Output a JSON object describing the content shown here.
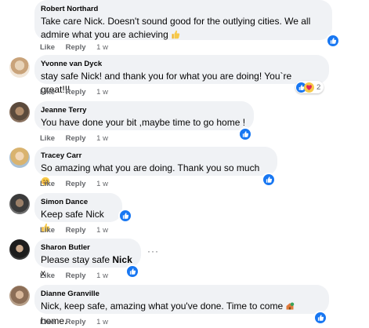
{
  "comments": [
    {
      "author": "Robert Northard",
      "text": "Take care Nick. Doesn't sound good for the outlying cities. We all admire what you are achieving",
      "line1": "Take care Nick. Doesn't sound good for the outlying cities. We all",
      "line2": "admire what you are achieving",
      "emoji": "thumbs-up-emoji",
      "like": "Like",
      "reply": "Reply",
      "time": "1 w"
    },
    {
      "author": "Yvonne van Dyck",
      "text": "stay safe Nick! and thank you for what you are doing! You`re great!!!",
      "like": "Like",
      "reply": "Reply",
      "time": "1 w",
      "reaction_count": "2"
    },
    {
      "author": "Jeanne Terry",
      "text": "You have done your bit ,maybe time to go home !",
      "like": "Like",
      "reply": "Reply",
      "time": "1 w"
    },
    {
      "author": "Tracey Carr",
      "text": "So amazing what you are doing. Thank you so much",
      "emoji": "smiling-face-emoji",
      "like": "Like",
      "reply": "Reply",
      "time": "1 w"
    },
    {
      "author": "Simon Dance",
      "text": "Keep safe Nick",
      "emoji": "thumbs-up-emoji",
      "like": "Like",
      "reply": "Reply",
      "time": "1 w"
    },
    {
      "author": "Sharon Butler",
      "text_before": "Please stay safe ",
      "text_bold": "Nick",
      "text_after": " x",
      "like": "Like",
      "reply": "Reply",
      "time": "1 w"
    },
    {
      "author": "Dianne Granville",
      "text_before": "Nick, keep safe, amazing what you've done. Time to come ",
      "text_after": " home.",
      "emoji": "house-emoji",
      "like": "Like",
      "reply": "Reply",
      "time": "1 w"
    }
  ],
  "colors": {
    "bubble": "#f0f2f5",
    "like_blue": "#1877f2",
    "meta_gray": "#65676b",
    "text": "#050505"
  },
  "icons": {
    "like_badge": "thumbs-up-icon",
    "more": "more-options-icon"
  }
}
